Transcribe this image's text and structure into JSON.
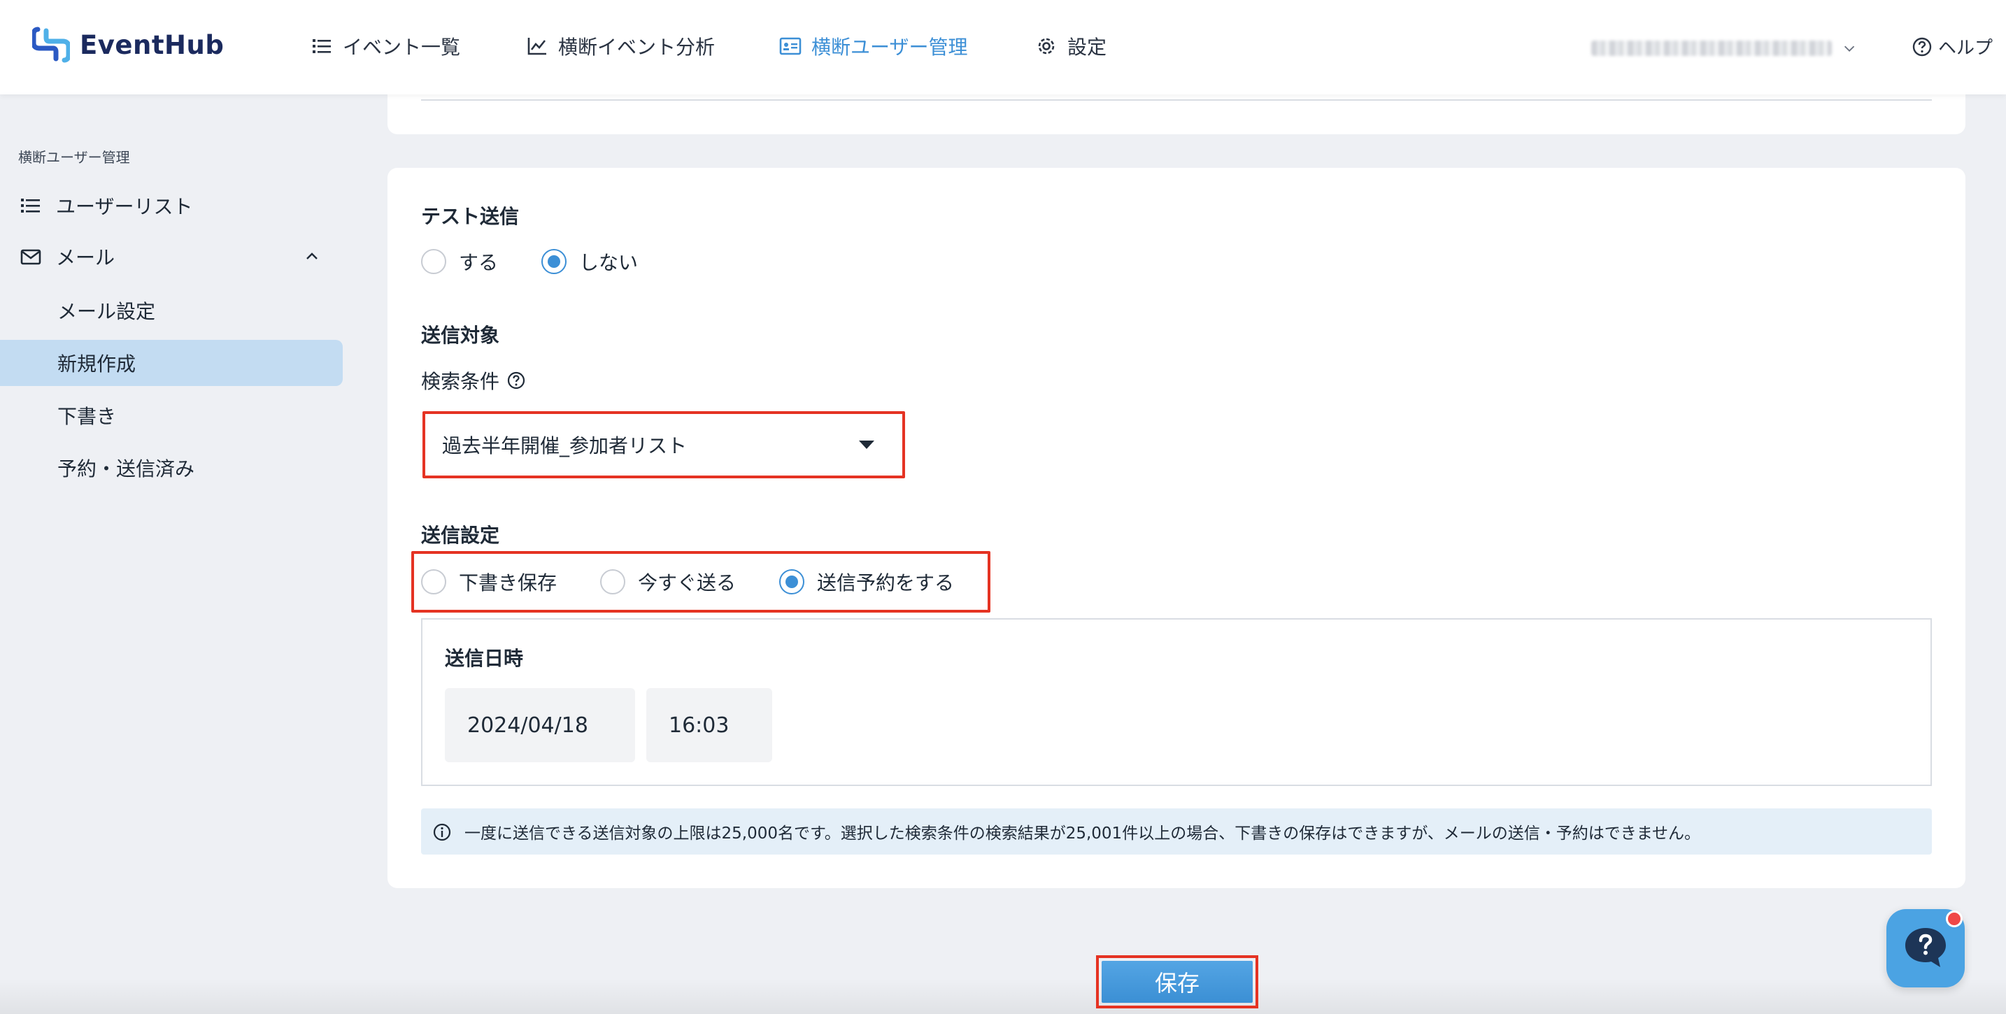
{
  "app": {
    "logo_text": "EventHub"
  },
  "nav": {
    "items": [
      {
        "label": "イベント一覧",
        "icon": "list-icon"
      },
      {
        "label": "横断イベント分析",
        "icon": "chart-line-icon"
      },
      {
        "label": "横断ユーザー管理",
        "icon": "id-card-icon",
        "active": true
      },
      {
        "label": "設定",
        "icon": "gear-icon"
      }
    ],
    "help_label": "ヘルプ"
  },
  "sidebar": {
    "title": "横断ユーザー管理",
    "user_list": "ユーザーリスト",
    "mail": "メール",
    "sub_items": [
      "メール設定",
      "新規作成",
      "下書き",
      "予約・送信済み"
    ],
    "active_sub": "新規作成"
  },
  "form": {
    "test_send": {
      "label": "テスト送信",
      "options": [
        "する",
        "しない"
      ],
      "selected": "しない"
    },
    "target": {
      "label": "送信対象",
      "condition_label": "検索条件",
      "condition_value": "過去半年開催_参加者リスト"
    },
    "send_setting": {
      "label": "送信設定",
      "options": [
        "下書き保存",
        "今すぐ送る",
        "送信予約をする"
      ],
      "selected": "送信予約をする"
    },
    "schedule": {
      "label": "送信日時",
      "date": "2024/04/18",
      "time": "16:03"
    },
    "notice": "一度に送信できる送信対象の上限は25,000名です。選択した検索条件の検索結果が25,001件以上の場合、下書きの保存はできますが、メールの送信・予約はできません。"
  },
  "actions": {
    "save_label": "保存"
  },
  "colors": {
    "accent": "#3c8fd6",
    "highlight": "#e53323",
    "active_bg": "#c3dcf2"
  }
}
